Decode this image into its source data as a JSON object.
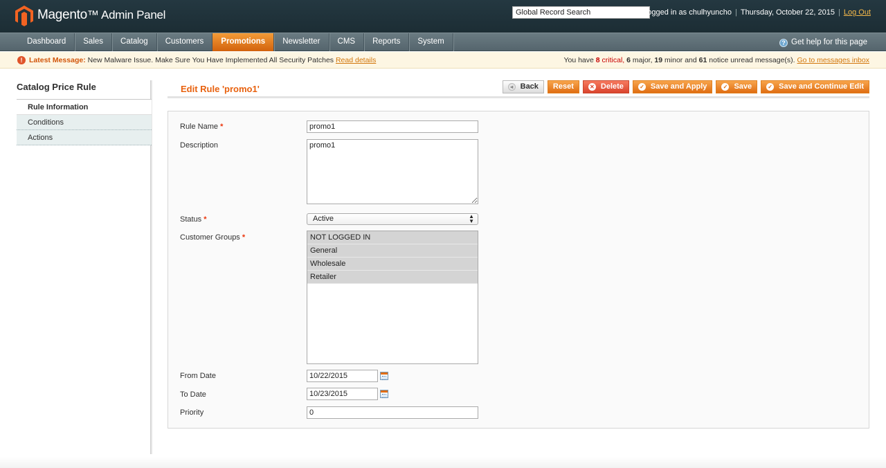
{
  "header": {
    "brand": "Magento",
    "brand_sub": "Admin Panel",
    "search_value": "Global Record Search",
    "logged_in": "Logged in as chulhyuncho",
    "date": "Thursday, October 22, 2015",
    "logout": "Log Out"
  },
  "nav": {
    "items": [
      "Dashboard",
      "Sales",
      "Catalog",
      "Customers",
      "Promotions",
      "Newsletter",
      "CMS",
      "Reports",
      "System"
    ],
    "active": "Promotions",
    "help": "Get help for this page"
  },
  "message": {
    "label": "Latest Message:",
    "text": "New Malware Issue. Make Sure You Have Implemented All Security Patches",
    "link": "Read details",
    "right_prefix": "You have",
    "critical_count": "8",
    "critical_label": "critical,",
    "major_count": "6",
    "major_label": "major,",
    "minor_count": "19",
    "minor_label": "minor and",
    "notice_count": "61",
    "notice_label": "notice unread message(s).",
    "inbox_link": "Go to messages inbox"
  },
  "sidebar": {
    "title": "Catalog Price Rule",
    "tabs": [
      "Rule Information",
      "Conditions",
      "Actions"
    ]
  },
  "content": {
    "title": "Edit Rule 'promo1'",
    "buttons": {
      "back": "Back",
      "reset": "Reset",
      "delete": "Delete",
      "save_apply": "Save and Apply",
      "save": "Save",
      "save_continue": "Save and Continue Edit"
    }
  },
  "form": {
    "rule_name_label": "Rule Name",
    "rule_name": "promo1",
    "description_label": "Description",
    "description": "promo1",
    "status_label": "Status",
    "status": "Active",
    "groups_label": "Customer Groups",
    "groups": [
      "NOT LOGGED IN",
      "General",
      "Wholesale",
      "Retailer"
    ],
    "from_label": "From Date",
    "from_date": "10/22/2015",
    "to_label": "To Date",
    "to_date": "10/23/2015",
    "priority_label": "Priority",
    "priority": "0",
    "required_mark": "*"
  },
  "colors": {
    "accent": "#e8610e",
    "header_bg": "#1f323a",
    "nav_active": "#e67a1e"
  }
}
